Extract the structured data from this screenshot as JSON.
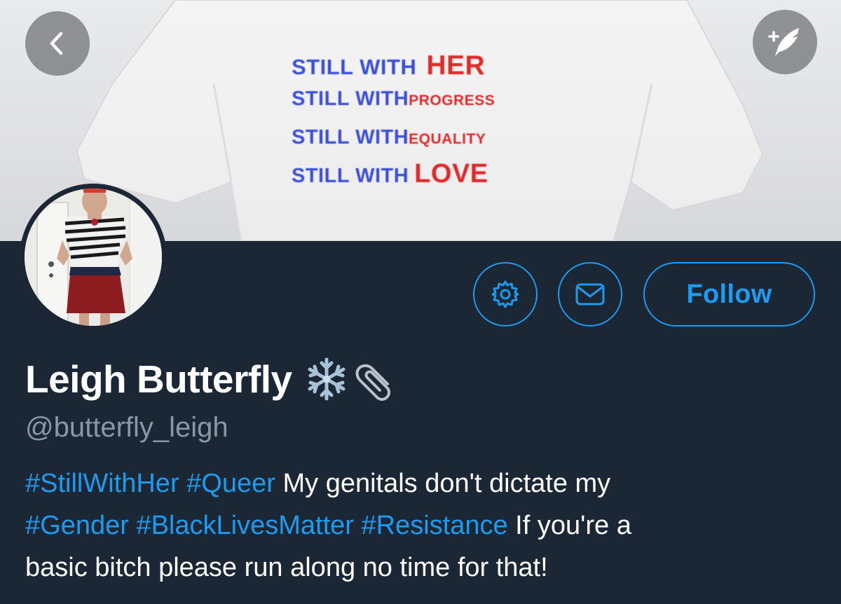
{
  "banner": {
    "shirt_lines": [
      {
        "blue": "STILL WITH",
        "red": "HER"
      },
      {
        "blue": "STILL WITH",
        "red": "PROGRESS"
      },
      {
        "blue": "STILL WITH",
        "red": "EQUALITY"
      },
      {
        "blue": "STILL WITH",
        "red": "LOVE"
      }
    ]
  },
  "nav": {
    "back_icon": "chevron-left-icon",
    "compose_icon": "compose-tweet-icon"
  },
  "actions": {
    "settings_icon": "gear-icon",
    "message_icon": "envelope-icon",
    "follow_label": "Follow"
  },
  "profile": {
    "display_name": "Leigh Butterfly",
    "name_emojis": [
      "snowflake-icon",
      "paperclip-icon"
    ],
    "handle": "@butterfly_leigh",
    "bio": {
      "tag1": "#StillWithHer",
      "tag2": "#Queer",
      "text1": "My genitals don't dictate my",
      "tag3": "#Gender",
      "tag4": "#BlackLivesMatter",
      "tag5": "#Resistance",
      "text2": "If you're a",
      "text3": "basic bitch please run along no time for that!"
    }
  },
  "colors": {
    "background": "#1b2735",
    "accent": "#1d9bf0",
    "secondary_text": "#8899a6",
    "shirt_blue": "#3a4fd6",
    "shirt_red": "#e02a2a"
  }
}
